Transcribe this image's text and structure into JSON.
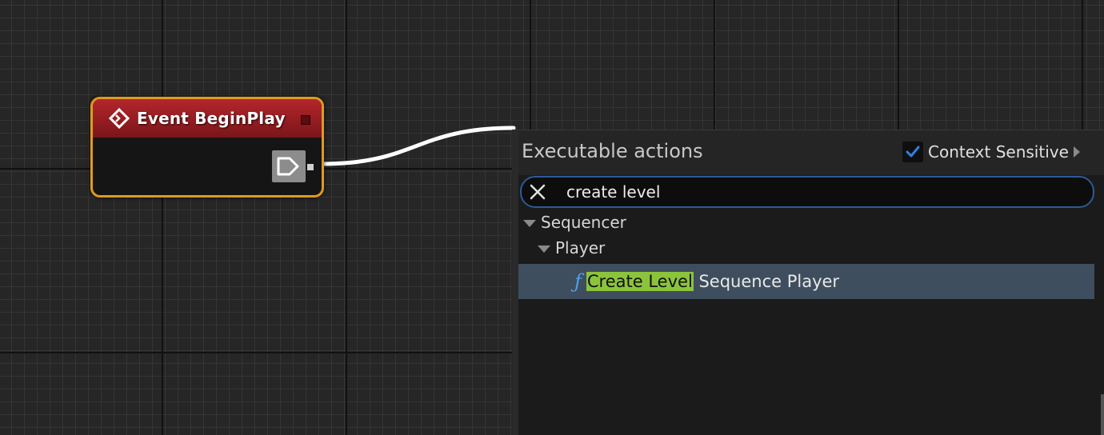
{
  "node": {
    "title": "Event BeginPlay"
  },
  "action_menu": {
    "title": "Executable actions",
    "context_sensitive_label": "Context Sensitive",
    "context_sensitive_checked": true,
    "search_value": "create level",
    "tree": {
      "category": "Sequencer",
      "subcategory": "Player",
      "item": {
        "match_text": "Create Level",
        "rest_text": " Sequence Player",
        "icon": "function-icon"
      }
    }
  },
  "colors": {
    "node_border": "#e09a1e",
    "node_header": "#b3262c",
    "search_border": "#2c5b97",
    "selection": "#3e4e5e",
    "match_highlight": "#8bc43c",
    "function_icon": "#4fa0e8",
    "checkbox_check": "#2f7fe0"
  }
}
